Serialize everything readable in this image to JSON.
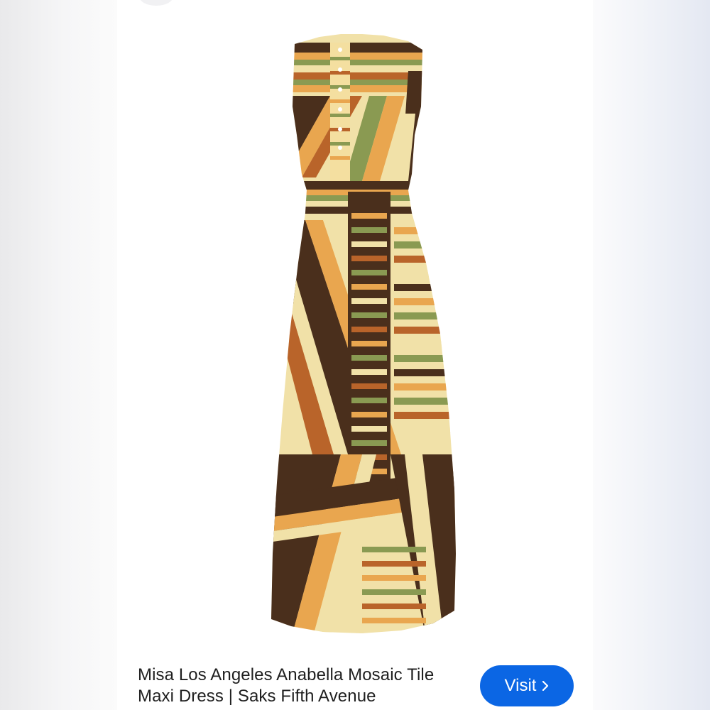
{
  "result": {
    "title": "Misa Los Angeles Anabella Mosaic Tile Maxi Dress | Saks Fifth Avenue",
    "visit_label": "Visit",
    "visit_icon": "chevron-right-icon",
    "image_subject": "Misa Los Angeles Anabella Mosaic Tile Maxi Dress"
  },
  "colors": {
    "visit_button": "#0b66e4",
    "dress_brown": "#4a2f1c",
    "dress_orange": "#e9a64f",
    "dress_cream": "#f1e1a8",
    "dress_green": "#8a9a52",
    "dress_rust": "#b9642a"
  }
}
